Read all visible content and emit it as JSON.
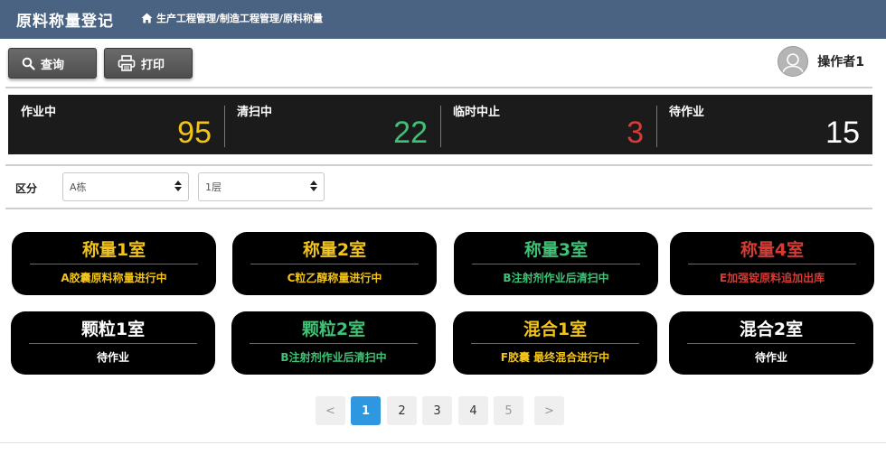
{
  "header": {
    "title": "原料称量登记",
    "breadcrumb": "生产工程管理/制造工程管理/原料称量"
  },
  "toolbar": {
    "search_label": "查询",
    "print_label": "打印"
  },
  "operator": {
    "name": "操作者1"
  },
  "status": [
    {
      "label": "作业中",
      "value": "95",
      "color": "#f2c318"
    },
    {
      "label": "清扫中",
      "value": "22",
      "color": "#3fc275"
    },
    {
      "label": "临时中止",
      "value": "3",
      "color": "#d63b35"
    },
    {
      "label": "待作业",
      "value": "15",
      "color": "#ffffff"
    }
  ],
  "filter": {
    "label": "区分",
    "building": "A栋",
    "floor": "1层"
  },
  "rooms": [
    {
      "name": "称量1室",
      "status": "A胶囊原料称量进行中",
      "color": "#f2c318"
    },
    {
      "name": "称量2室",
      "status": "C粒乙醇称量进行中",
      "color": "#f2c318"
    },
    {
      "name": "称量3室",
      "status": "B注射剂作业后清扫中",
      "color": "#3fc275"
    },
    {
      "name": "称量4室",
      "status": "E加强锭原料追加出库",
      "color": "#d63b35"
    },
    {
      "name": "颗粒1室",
      "status": "待作业",
      "color": "#ffffff"
    },
    {
      "name": "颗粒2室",
      "status": "B注射剂作业后清扫中",
      "color": "#3fc275"
    },
    {
      "name": "混合1室",
      "status": "F胶囊 最终混合进行中",
      "color": "#f2c318"
    },
    {
      "name": "混合2室",
      "status": "待作业",
      "color": "#ffffff"
    }
  ],
  "pagination": {
    "prev": "<",
    "next": ">",
    "pages": [
      "1",
      "2",
      "3",
      "4",
      "5"
    ],
    "current": "1"
  }
}
